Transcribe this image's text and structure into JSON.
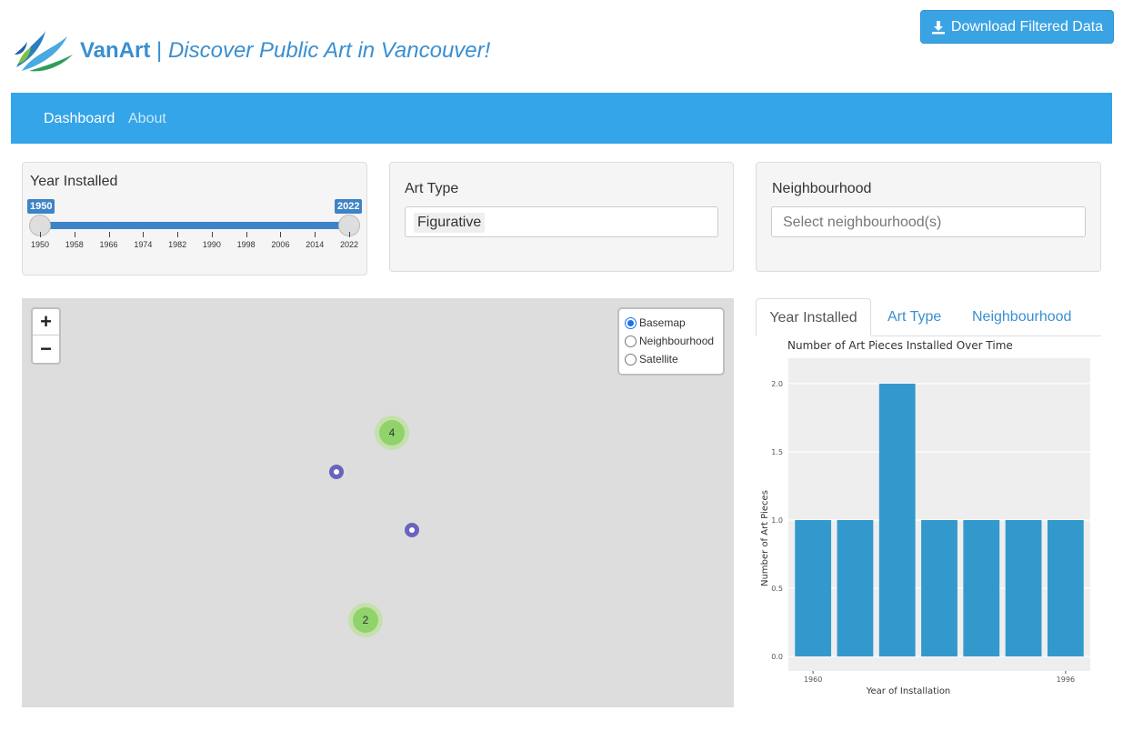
{
  "header": {
    "brand": "VanArt",
    "separator": " | ",
    "tagline": "Discover Public Art in Vancouver!",
    "logo_icon": "vanart-leaf-logo",
    "download_label": "Download Filtered Data",
    "download_icon": "download-icon"
  },
  "nav": {
    "items": [
      {
        "label": "Dashboard",
        "active": true
      },
      {
        "label": "About",
        "active": false
      }
    ]
  },
  "filters": {
    "year": {
      "label": "Year Installed",
      "min": 1950,
      "max": 2022,
      "value_low": "1950",
      "value_high": "2022",
      "ticks": [
        "1950",
        "1958",
        "1966",
        "1974",
        "1982",
        "1990",
        "1998",
        "2006",
        "2014",
        "2022"
      ]
    },
    "art_type": {
      "label": "Art Type",
      "selected": "Figurative"
    },
    "neighbourhood": {
      "label": "Neighbourhood",
      "placeholder": "Select neighbourhood(s)"
    }
  },
  "map": {
    "zoom_in": "+",
    "zoom_out": "−",
    "layers": [
      {
        "label": "Basemap",
        "checked": true
      },
      {
        "label": "Neighbourhood",
        "checked": false
      },
      {
        "label": "Satellite",
        "checked": false
      }
    ],
    "clusters": [
      {
        "count": "4"
      },
      {
        "count": "2"
      }
    ],
    "marker_color": "#6a63be",
    "cluster_color": "#8fd36a"
  },
  "tabs": {
    "items": [
      "Year Installed",
      "Art Type",
      "Neighbourhood"
    ],
    "active": "Year Installed"
  },
  "chart_data": {
    "type": "bar",
    "title": "Number of Art Pieces Installed Over Time",
    "xlabel": "Year of Installation",
    "ylabel": "Number of Art Pieces",
    "values": [
      1,
      1,
      2,
      1,
      1,
      1,
      1
    ],
    "x_tick_labels": [
      "1960",
      "1996"
    ],
    "y_ticks": [
      "0.0",
      "0.5",
      "1.0",
      "1.5",
      "2.0"
    ],
    "ylim": [
      0,
      2
    ],
    "bar_color": "#3399cc",
    "grid": true
  }
}
